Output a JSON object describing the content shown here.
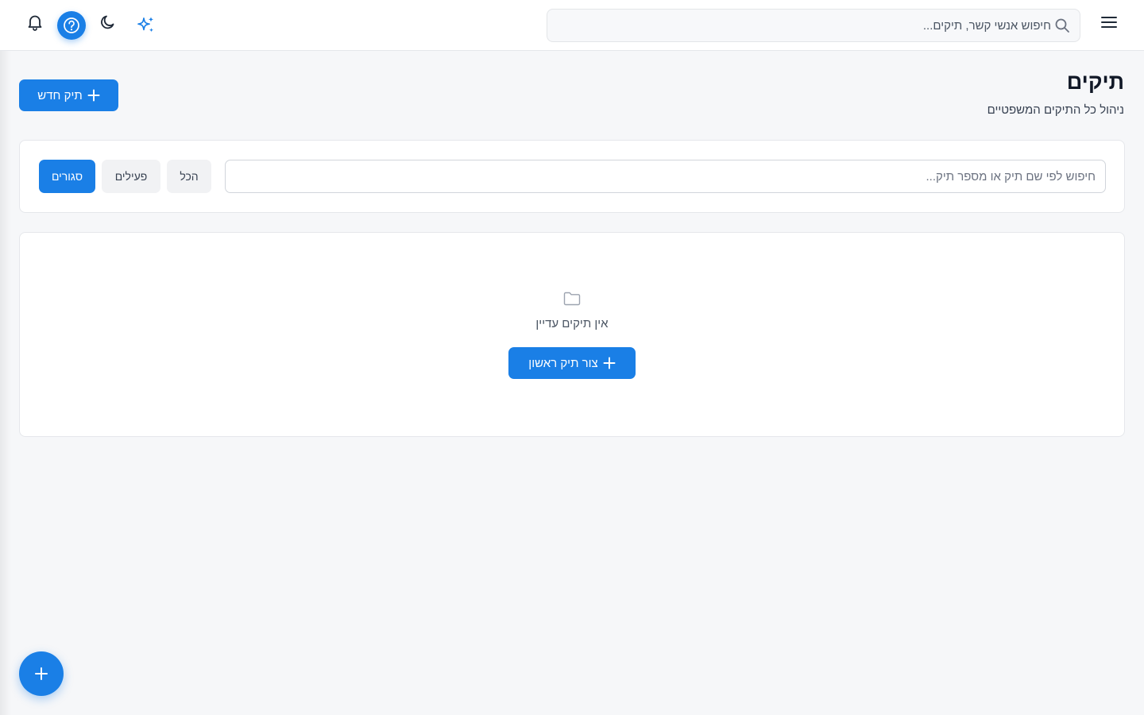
{
  "header": {
    "search_placeholder": "חיפוש אנשי קשר, תיקים..."
  },
  "icons": {
    "menu": "hamburger-menu-icon",
    "search": "search-icon",
    "sparkle": "sparkle-icon",
    "moon": "moon-icon",
    "help": "help-icon",
    "bell": "bell-icon",
    "folder": "folder-icon",
    "plus": "plus-icon"
  },
  "page": {
    "title": "תיקים",
    "subtitle": "ניהול כל התיקים המשפטיים",
    "new_case_label": "תיק חדש"
  },
  "filters": {
    "search_placeholder": "חיפוש לפי שם תיק או מספר תיק...",
    "options": [
      "הכל",
      "פעילים",
      "סגורים"
    ],
    "selected": "סגורים"
  },
  "empty_state": {
    "message": "אין תיקים עדיין",
    "create_first_label": "צור תיק ראשון"
  },
  "colors": {
    "accent": "#1a7fe6",
    "background": "#f6f7f9",
    "card": "#ffffff"
  }
}
